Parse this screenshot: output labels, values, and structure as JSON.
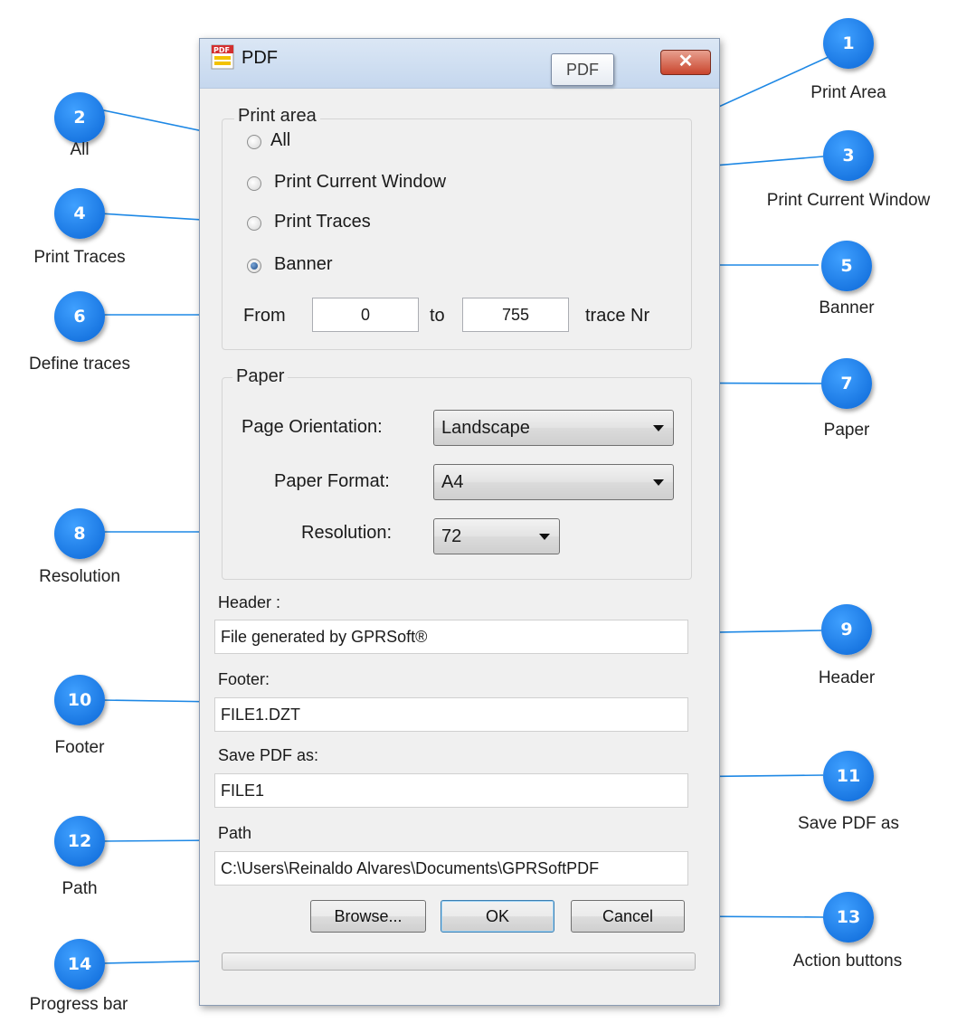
{
  "window": {
    "title": "PDF",
    "tooltip": "PDF",
    "close_label": "✕"
  },
  "print_area": {
    "legend": "Print area",
    "options": [
      {
        "label": "All",
        "checked": false
      },
      {
        "label": "Print Current Window",
        "checked": false
      },
      {
        "label": "Print Traces",
        "checked": false
      },
      {
        "label": "Banner",
        "checked": true
      }
    ],
    "from_label": "From",
    "from_value": "0",
    "to_label": "to",
    "to_value": "755",
    "trace_label": "trace Nr"
  },
  "paper": {
    "legend": "Paper",
    "orientation_label": "Page Orientation:",
    "orientation_value": "Landscape",
    "format_label": "Paper Format:",
    "format_value": "A4",
    "resolution_label": "Resolution:",
    "resolution_value": "72"
  },
  "header": {
    "label": "Header :",
    "value": "File generated by GPRSoft®"
  },
  "footer": {
    "label": "Footer:",
    "value": "FILE1.DZT"
  },
  "save_as": {
    "label": "Save PDF as:",
    "value": "FILE1"
  },
  "path": {
    "label": "Path",
    "value": "C:\\Users\\Reinaldo Alvares\\Documents\\GPRSoftPDF"
  },
  "buttons": {
    "browse": "Browse...",
    "ok": "OK",
    "cancel": "Cancel"
  },
  "progress": {
    "value": 0
  },
  "callouts": [
    {
      "num": "1",
      "caption": "Print Area"
    },
    {
      "num": "2",
      "caption": "All"
    },
    {
      "num": "3",
      "caption": "Print Current Window"
    },
    {
      "num": "4",
      "caption": "Print Traces"
    },
    {
      "num": "5",
      "caption": "Banner"
    },
    {
      "num": "6",
      "caption": "Define traces"
    },
    {
      "num": "7",
      "caption": "Paper"
    },
    {
      "num": "8",
      "caption": "Resolution"
    },
    {
      "num": "9",
      "caption": "Header"
    },
    {
      "num": "10",
      "caption": "Footer"
    },
    {
      "num": "11",
      "caption": "Save PDF as"
    },
    {
      "num": "12",
      "caption": "Path"
    },
    {
      "num": "13",
      "caption": "Action buttons"
    },
    {
      "num": "14",
      "caption": "Progress bar"
    }
  ],
  "colors": {
    "callout": "#1a7fe8",
    "leader_line": "#1e88e5",
    "close_button": "#c9452d"
  }
}
